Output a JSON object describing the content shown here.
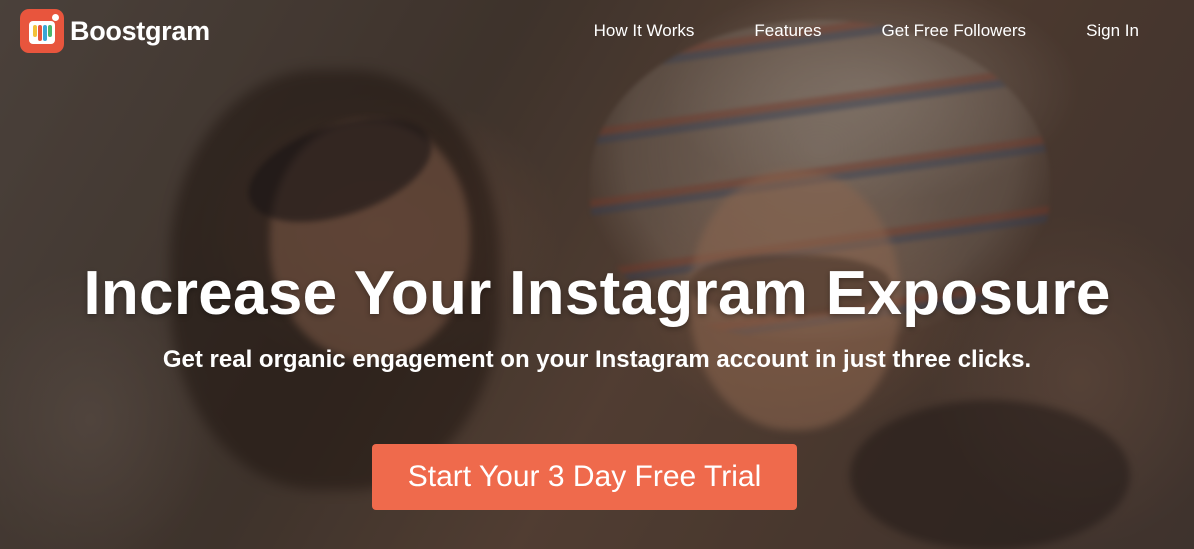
{
  "brand": {
    "name": "Boostgram",
    "accent_color": "#e8553d",
    "logo_icon": "heart-bars-icon"
  },
  "nav": {
    "links": [
      {
        "label": "How It Works"
      },
      {
        "label": "Features"
      },
      {
        "label": "Get Free Followers"
      },
      {
        "label": "Sign In"
      }
    ]
  },
  "hero": {
    "headline": "Increase Your Instagram Exposure",
    "subheadline": "Get real organic engagement on your Instagram account in just three clicks.",
    "cta_label": "Start Your 3 Day Free Trial",
    "cta_color": "#ef6a4c",
    "background": "blurred-photo-of-smiling-women-taking-selfie"
  }
}
